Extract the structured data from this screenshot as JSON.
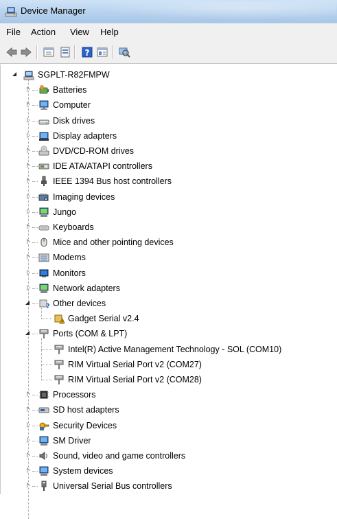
{
  "window": {
    "title": "Device Manager"
  },
  "menu": {
    "items": [
      "File",
      "Action",
      "View",
      "Help"
    ]
  },
  "toolbar": {
    "buttons": [
      "back-icon",
      "forward-icon",
      "properties-icon",
      "update-driver-icon",
      "help-icon",
      "details-icon",
      "scan-hardware-icon"
    ]
  },
  "tree": {
    "root": "SGPLT-R82FMPW",
    "categories": [
      {
        "label": "Batteries",
        "icon": "battery-icon"
      },
      {
        "label": "Computer",
        "icon": "computer-icon"
      },
      {
        "label": "Disk drives",
        "icon": "disk-drive-icon"
      },
      {
        "label": "Display adapters",
        "icon": "display-adapter-icon"
      },
      {
        "label": "DVD/CD-ROM drives",
        "icon": "dvd-drive-icon"
      },
      {
        "label": "IDE ATA/ATAPI controllers",
        "icon": "ide-controller-icon"
      },
      {
        "label": "IEEE 1394 Bus host controllers",
        "icon": "ieee1394-icon"
      },
      {
        "label": "Imaging devices",
        "icon": "imaging-device-icon"
      },
      {
        "label": "Jungo",
        "icon": "jungo-icon"
      },
      {
        "label": "Keyboards",
        "icon": "keyboard-icon"
      },
      {
        "label": "Mice and other pointing devices",
        "icon": "mouse-icon"
      },
      {
        "label": "Modems",
        "icon": "modem-icon"
      },
      {
        "label": "Monitors",
        "icon": "monitor-icon"
      },
      {
        "label": "Network adapters",
        "icon": "network-adapter-icon"
      },
      {
        "label": "Other devices",
        "icon": "other-devices-icon",
        "expanded": true,
        "children": [
          {
            "label": "Gadget Serial v2.4",
            "icon": "warning-device-icon"
          }
        ]
      },
      {
        "label": "Ports (COM & LPT)",
        "icon": "port-icon",
        "expanded": true,
        "children": [
          {
            "label": "Intel(R) Active Management Technology - SOL (COM10)",
            "icon": "port-icon"
          },
          {
            "label": "RIM Virtual Serial Port v2 (COM27)",
            "icon": "port-icon"
          },
          {
            "label": "RIM Virtual Serial Port v2 (COM28)",
            "icon": "port-icon"
          }
        ]
      },
      {
        "label": "Processors",
        "icon": "processor-icon"
      },
      {
        "label": "SD host adapters",
        "icon": "sd-adapter-icon"
      },
      {
        "label": "Security Devices",
        "icon": "security-device-icon"
      },
      {
        "label": "SM Driver",
        "icon": "sm-driver-icon"
      },
      {
        "label": "Sound, video and game controllers",
        "icon": "sound-icon"
      },
      {
        "label": "System devices",
        "icon": "system-devices-icon"
      },
      {
        "label": "Universal Serial Bus controllers",
        "icon": "usb-icon"
      }
    ]
  }
}
